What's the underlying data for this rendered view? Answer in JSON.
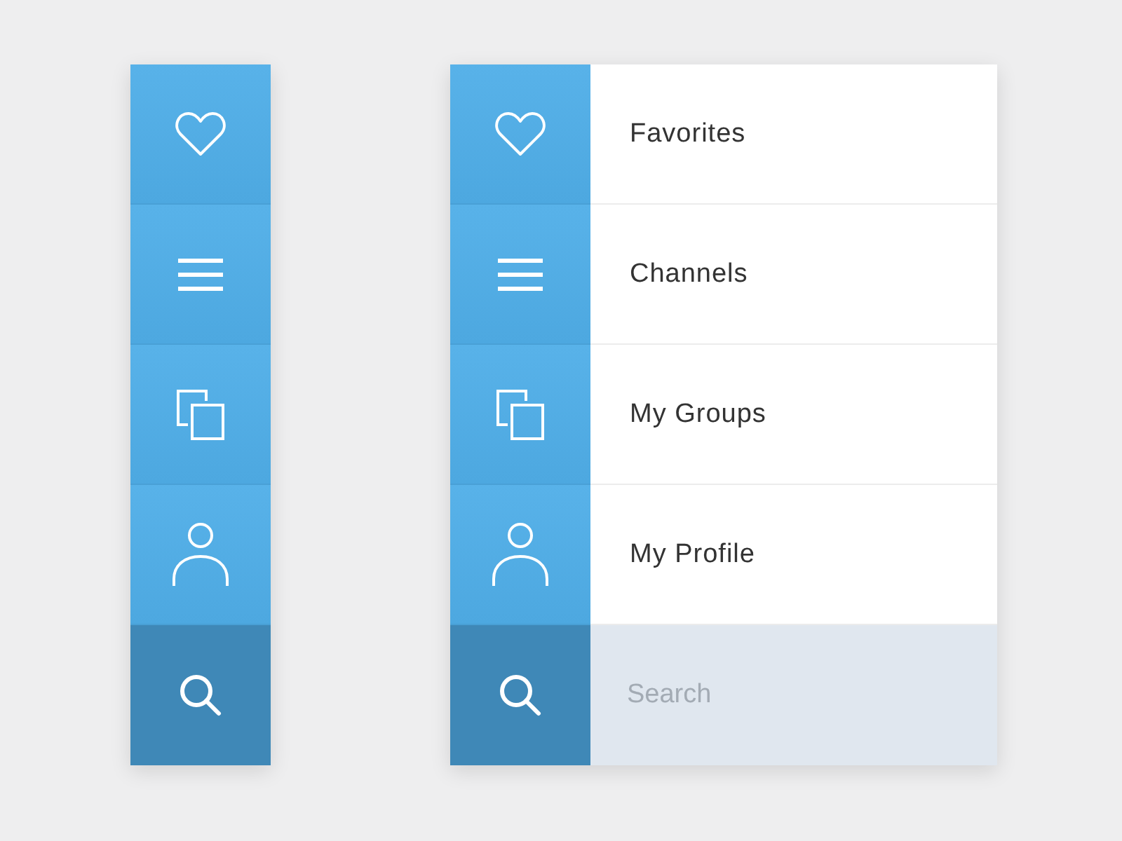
{
  "collapsed_menu": {
    "items": [
      {
        "kind": "heart"
      },
      {
        "kind": "list"
      },
      {
        "kind": "copies"
      },
      {
        "kind": "person"
      },
      {
        "kind": "search"
      }
    ]
  },
  "expanded_menu": {
    "items": [
      {
        "kind": "heart",
        "label": "Favorites"
      },
      {
        "kind": "list",
        "label": "Channels"
      },
      {
        "kind": "copies",
        "label": "My Groups"
      },
      {
        "kind": "person",
        "label": "My Profile"
      }
    ],
    "search": {
      "placeholder": "Search"
    }
  }
}
